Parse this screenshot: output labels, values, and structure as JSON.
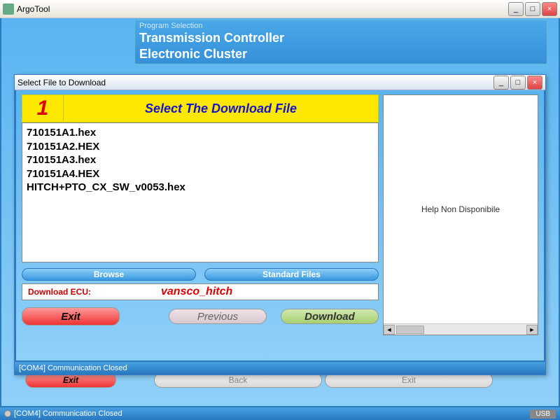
{
  "main": {
    "title": "ArgoTool",
    "program_selection": {
      "label": "Program Selection",
      "options": [
        "Transmission Controller",
        "Electronic Cluster"
      ]
    },
    "buttons": {
      "exit": "Exit",
      "back": "Back",
      "exit2": "Exit"
    },
    "status": "[COM4] Communication Closed",
    "usb": "USB"
  },
  "dialog": {
    "title": "Select File to Download",
    "step": "1",
    "step_title": "Select The Download File",
    "files": [
      "710151A1.hex",
      "710151A2.HEX",
      "710151A3.hex",
      "710151A4.HEX",
      "HITCH+PTO_CX_SW_v0053.hex"
    ],
    "browse": "Browse",
    "standard_files": "Standard Files",
    "ecu_label": "Download ECU:",
    "ecu_value": "vansco_hitch",
    "exit": "Exit",
    "previous": "Previous",
    "download": "Download",
    "help": "Help Non Disponibile",
    "status": "[COM4] Communication Closed"
  }
}
